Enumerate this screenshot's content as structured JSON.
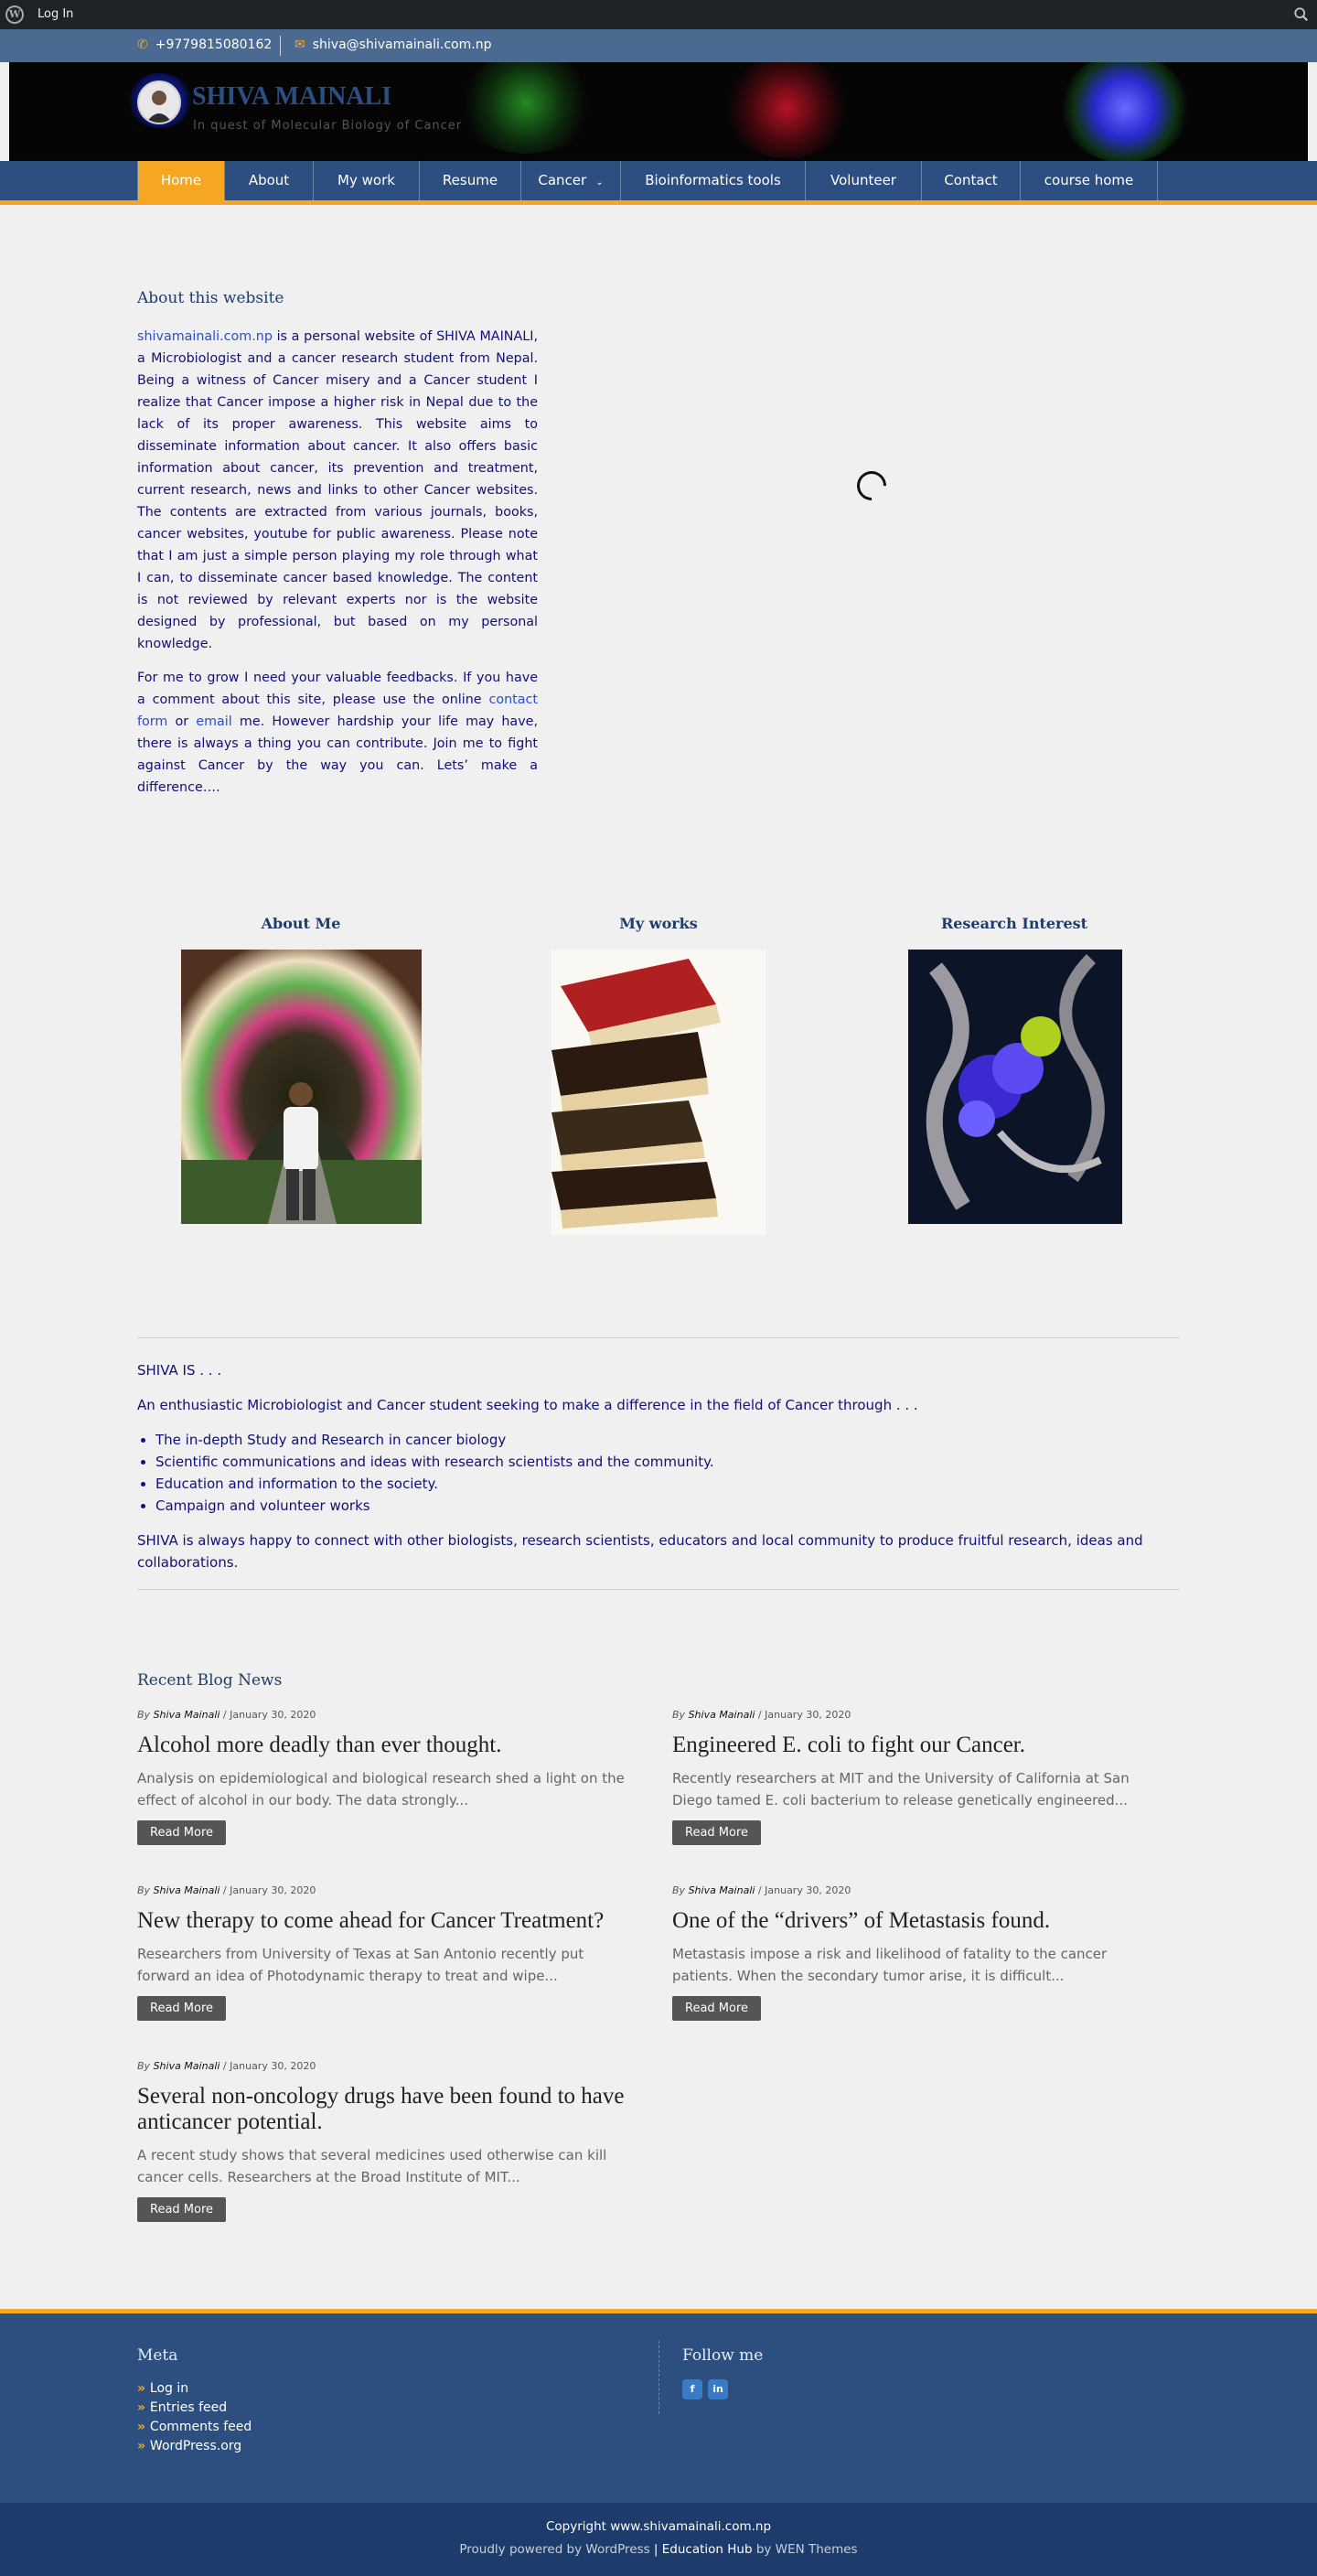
{
  "admin_bar": {
    "login": "Log In"
  },
  "topbar": {
    "phone": "+9779815080162",
    "email": "shiva@shivamainali.com.np"
  },
  "header": {
    "site_title": "SHIVA MAINALI",
    "tagline": "In quest of Molecular Biology of Cancer"
  },
  "nav": [
    "Home",
    "About",
    "My work",
    "Resume",
    "Cancer",
    "Bioinformatics tools",
    "Volunteer",
    "Contact",
    "course home"
  ],
  "about": {
    "title": "About this website",
    "p1_link": "shivamainali.com.np",
    "p1_rest": " is a personal website of SHIVA MAINALI, a Microbiologist and a cancer research student from Nepal. Being a witness of Cancer misery and a Cancer student I realize that Cancer impose a higher risk in Nepal due to the lack of its proper awareness. This website aims to disseminate information about cancer. It also offers basic information about cancer, its prevention and treatment, current research, news and links to other Cancer websites. The contents are extracted from various journals, books, cancer websites, youtube for public awareness. Please note that I am just a simple person playing my role through what I can, to disseminate cancer based knowledge. The content is not reviewed by relevant experts nor is the website designed by professional, but based on my personal knowledge.",
    "p2_a": "For me to grow I need your valuable feedbacks. If you have a comment about this site, please use the online ",
    "p2_link1": "contact form",
    "p2_b": " or ",
    "p2_link2": "email",
    "p2_c": " me. However hardship your life may have, there is always a thing you can contribute.  Join me to fight against Cancer by the way you can. Lets’ make a difference…."
  },
  "columns": [
    "About Me",
    "My works",
    "Research Interest"
  ],
  "shiva_is": {
    "heading": "SHIVA IS . . .",
    "intro": "An enthusiastic Microbiologist and Cancer student seeking to make a difference in the field of Cancer through . . .",
    "items": [
      "The in-depth Study and Research in cancer biology",
      "Scientific communications and ideas with research scientists and the community.",
      "Education and information to the society.",
      "Campaign and volunteer works"
    ],
    "closing": "SHIVA is always happy to connect with other biologists, research scientists, educators and local community to produce fruitful research, ideas and collaborations."
  },
  "blog": {
    "title": "Recent Blog News",
    "by": "By",
    "read_more": "Read More",
    "posts": [
      {
        "author": "Shiva Mainali",
        "date": " / January 30, 2020",
        "title": "Alcohol more deadly than ever thought.",
        "excerpt": "Analysis on epidemiological and biological research shed a light on the effect of alcohol in our body. The data strongly..."
      },
      {
        "author": "Shiva Mainali",
        "date": " / January 30, 2020",
        "title": "Engineered E. coli to fight our Cancer.",
        "excerpt": "Recently researchers at MIT and the University of California at San Diego tamed E. coli bacterium to release genetically engineered..."
      },
      {
        "author": "Shiva Mainali",
        "date": " / January 30, 2020",
        "title": "New therapy to come ahead for Cancer Treatment?",
        "excerpt": "Researchers from University of Texas at San Antonio recently put forward an idea of Photodynamic therapy to treat and wipe..."
      },
      {
        "author": "Shiva Mainali",
        "date": " / January 30, 2020",
        "title": "One of the “drivers” of Metastasis found.",
        "excerpt": "Metastasis impose a risk and likelihood of fatality to the cancer patients. When the secondary tumor arise, it is difficult..."
      },
      {
        "author": "Shiva Mainali",
        "date": " / January 30, 2020",
        "title": "Several non-oncology drugs have been found to have anticancer potential.",
        "excerpt": "A recent study shows that several medicines used otherwise can kill cancer cells. Researchers at the Broad Institute of MIT..."
      }
    ]
  },
  "footer": {
    "meta_title": "Meta",
    "meta_links": [
      "Log in",
      "Entries feed",
      "Comments feed",
      "WordPress.org"
    ],
    "follow_title": "Follow me",
    "social": [
      "facebook-icon",
      "linkedin-icon"
    ]
  },
  "bottom": {
    "copyright": "Copyright www.shivamainali.com.np",
    "powered": "Proudly powered by WordPress",
    "separator": " | ",
    "theme_a": "Education Hub",
    "theme_by": " by ",
    "theme_b": "WEN Themes"
  },
  "colors": {
    "accent": "#f5a623",
    "nav": "#2c4f80",
    "topbar": "#4a6a92",
    "link": "#2a4dd0",
    "text": "#101078"
  }
}
